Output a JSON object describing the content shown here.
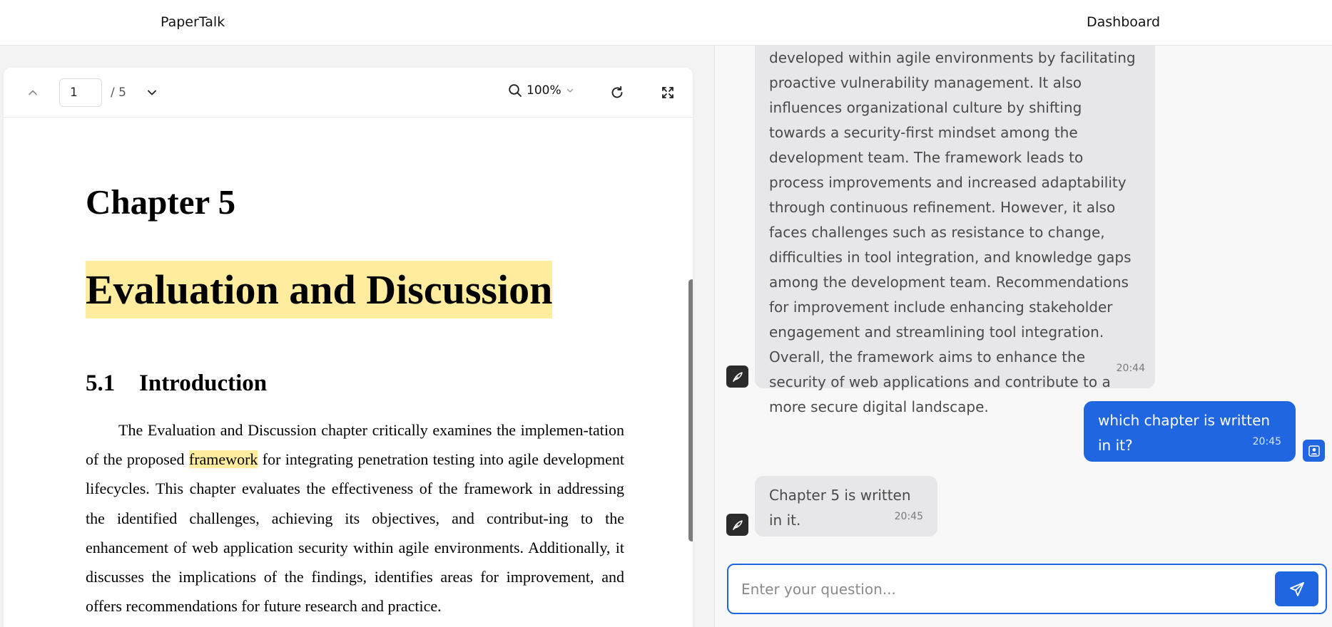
{
  "header": {
    "brand": "PaperTalk",
    "nav_dashboard": "Dashboard"
  },
  "viewer": {
    "page_current": "1",
    "page_total": "/ 5",
    "zoom": "100%",
    "document": {
      "chapter": "Chapter 5",
      "title": "Evaluation and Discussion",
      "section_number": "5.1",
      "section_title": "Introduction",
      "paragraph_before": "The Evaluation and Discussion chapter critically examines the implemen-tation of the proposed ",
      "paragraph_highlight": "framework",
      "paragraph_after": " for integrating penetration testing into agile development lifecycles. This chapter evaluates the effectiveness of the framework in addressing the identified challenges, achieving its objectives, and contribut-ing to the enhancement of web application security within agile environments. Additionally, it discusses the implications of the findings, identifies areas for improvement, and offers recommendations for future research and practice."
    }
  },
  "chat": {
    "messages": [
      {
        "role": "bot",
        "text": "developed within agile environments by facilitating proactive vulnerability management. It also influences organizational culture by shifting towards a security-first mindset among the development team. The framework leads to process improvements and increased adaptability through continuous refinement. However, it also faces challenges such as resistance to change, difficulties in tool integration, and knowledge gaps among the development team. Recommendations for improvement include enhancing stakeholder engagement and streamlining tool integration. Overall, the framework aims to enhance the security of web applications and contribute to a more secure digital landscape.",
        "time": "20:44"
      },
      {
        "role": "user",
        "text": "which chapter is written in it?",
        "time": "20:45"
      },
      {
        "role": "bot",
        "text": "Chapter 5 is written in it.",
        "time": "20:45"
      }
    ],
    "input_placeholder": "Enter your question..."
  },
  "icons": {
    "page_up": "chevron-up-icon",
    "page_down": "chevron-down-icon",
    "zoom": "search-icon",
    "rotate": "rotate-icon",
    "fullscreen": "fullscreen-icon",
    "bot_avatar": "feather-icon",
    "user_avatar": "user-icon",
    "send": "send-icon"
  },
  "colors": {
    "accent": "#1f66e0",
    "highlight": "#ffec9e",
    "bot_bubble": "#e7e7ea",
    "bot_avatar": "#2b2b2b"
  }
}
